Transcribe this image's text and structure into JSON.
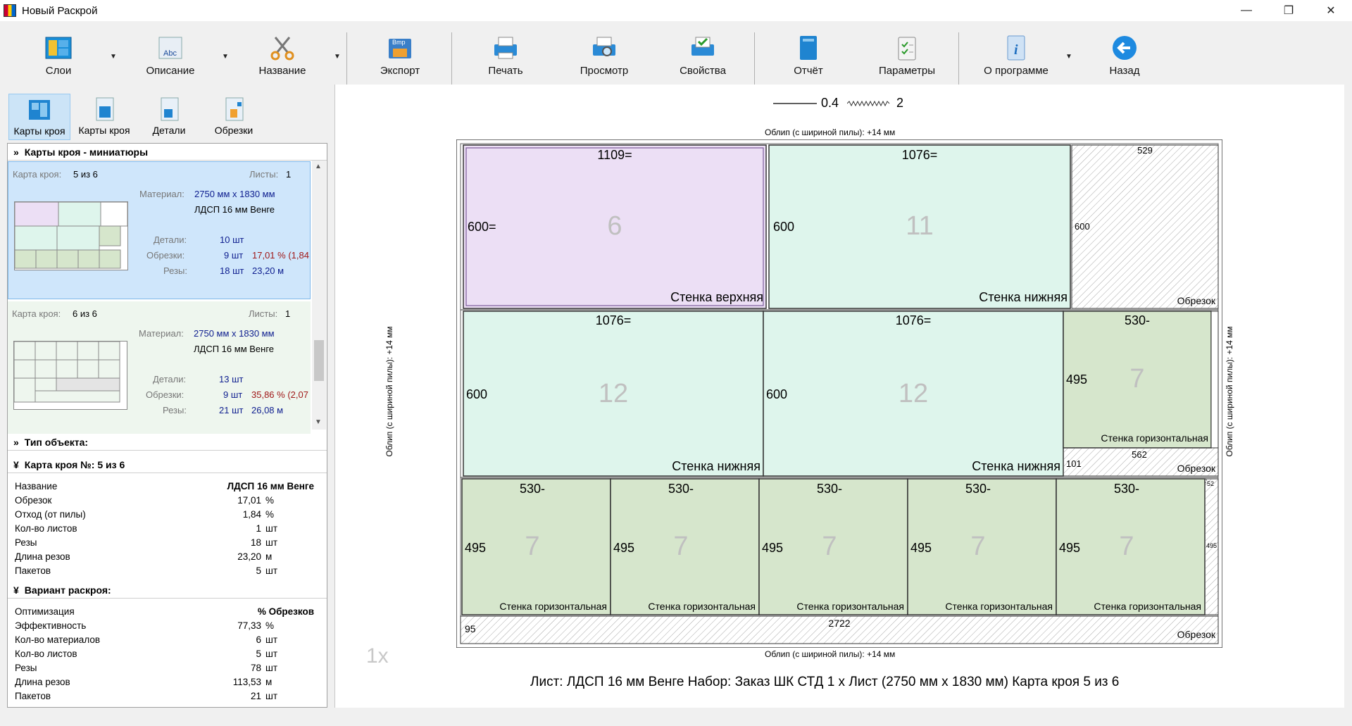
{
  "window": {
    "title": "Новый Раскрой",
    "minimize": "—",
    "maximize": "❐",
    "close": "✕"
  },
  "toolbar": {
    "layers": "Слои",
    "description": "Описание",
    "name": "Название",
    "export": "Экспорт",
    "print": "Печать",
    "preview": "Просмотр",
    "properties": "Свойства",
    "report": "Отчёт",
    "params": "Параметры",
    "about": "О программе",
    "back": "Назад",
    "bmp_badge": "Bmp",
    "abc_badge": "Abc"
  },
  "left_tabs": {
    "cut_maps_1": "Карты кроя",
    "cut_maps_2": "Карты кроя",
    "parts": "Детали",
    "offcuts": "Обрезки"
  },
  "thumbnails": {
    "header": "Карты кроя - миниатюры",
    "cards": [
      {
        "label": "Карта кроя:",
        "num": "5 из 6",
        "sheets_label": "Листы:",
        "sheets": "1",
        "material_label": "Материал:",
        "material": "2750 мм x 1830 мм",
        "material_name": "ЛДСП 16 мм Венге",
        "parts_label": "Детали:",
        "parts": "10 шт",
        "offcuts_label": "Обрезки:",
        "offcuts": "9 шт",
        "offcuts_pct": "17,01 % (1,84",
        "cuts_label": "Резы:",
        "cuts": "18 шт",
        "cuts_len": "23,20 м"
      },
      {
        "label": "Карта кроя:",
        "num": "6 из 6",
        "sheets_label": "Листы:",
        "sheets": "1",
        "material_label": "Материал:",
        "material": "2750 мм x 1830 мм",
        "material_name": "ЛДСП 16 мм Венге",
        "parts_label": "Детали:",
        "parts": "13 шт",
        "offcuts_label": "Обрезки:",
        "offcuts": "9 шт",
        "offcuts_pct": "35,86 % (2,07",
        "cuts_label": "Резы:",
        "cuts": "21 шт",
        "cuts_len": "26,08 м"
      }
    ]
  },
  "object_type": {
    "header": "Тип объекта:"
  },
  "cut_map": {
    "header": "Карта кроя №: 5 из 6",
    "rows": [
      {
        "name": "Название",
        "value": "ЛДСП 16 мм Венге",
        "unit": ""
      },
      {
        "name": "Обрезок",
        "value": "17,01",
        "unit": "%"
      },
      {
        "name": "Отход (от пилы)",
        "value": "1,84",
        "unit": "%"
      },
      {
        "name": "Кол-во листов",
        "value": "1",
        "unit": "шт"
      },
      {
        "name": "Резы",
        "value": "18",
        "unit": "шт"
      },
      {
        "name": "Длина резов",
        "value": "23,20",
        "unit": "м"
      },
      {
        "name": "Пакетов",
        "value": "5",
        "unit": "шт"
      }
    ]
  },
  "variant": {
    "header": "Вариант раскроя:",
    "rows": [
      {
        "name": "Оптимизация",
        "value": "% Обрезков",
        "unit": ""
      },
      {
        "name": "Эффективность",
        "value": "77,33",
        "unit": "%"
      },
      {
        "name": "Кол-во материалов",
        "value": "6",
        "unit": "шт"
      },
      {
        "name": "Кол-во листов",
        "value": "5",
        "unit": "шт"
      },
      {
        "name": "Резы",
        "value": "78",
        "unit": "шт"
      },
      {
        "name": "Длина резов",
        "value": "113,53",
        "unit": "м"
      },
      {
        "name": "Пакетов",
        "value": "21",
        "unit": "шт"
      }
    ]
  },
  "legend": {
    "line_value": "0.4",
    "wave_value": "2"
  },
  "edge_labels": {
    "top": "Облип (с шириной пилы): +14 мм",
    "bottom": "Облип (с шириной пилы): +14 мм",
    "left": "Облип (с шириной пилы): +14 мм",
    "right": "Облип (с шириной пилы): +14 мм"
  },
  "zoom": "1x",
  "footer": "Лист: ЛДСП 16 мм Венге  Набор: Заказ ШК СТД  1 х Лист (2750 мм х 1830 мм)  Карта кроя 5 из 6",
  "pieces": [
    {
      "w": "1109=",
      "h": "600=",
      "num": "6",
      "name": "Стенка верхняя",
      "color": "#ecdff5"
    },
    {
      "w": "1076=",
      "h": "600",
      "num": "11",
      "name": "Стенка нижняя",
      "color": "#def5ec"
    },
    {
      "w": "1076=",
      "h": "600",
      "num": "12",
      "name": "Стенка нижняя",
      "color": "#def5ec"
    },
    {
      "w": "1076=",
      "h": "600",
      "num": "12",
      "name": "Стенка нижняя",
      "color": "#def5ec"
    },
    {
      "w": "530-",
      "h": "495",
      "num": "7",
      "name": "Стенка горизонтальная",
      "color": "#d6e6cc"
    },
    {
      "w": "530-",
      "h": "495",
      "num": "7",
      "name": "Стенка горизонтальная",
      "color": "#d6e6cc"
    },
    {
      "w": "530-",
      "h": "495",
      "num": "7",
      "name": "Стенка горизонтальная",
      "color": "#d6e6cc"
    },
    {
      "w": "530-",
      "h": "495",
      "num": "7",
      "name": "Стенка горизонтальная",
      "color": "#d6e6cc"
    },
    {
      "w": "530-",
      "h": "495",
      "num": "7",
      "name": "Стенка горизонтальная",
      "color": "#d6e6cc"
    },
    {
      "w": "530-",
      "h": "495",
      "num": "7",
      "name": "Стенка горизонтальная",
      "color": "#d6e6cc"
    }
  ],
  "offcuts": [
    {
      "w": "529",
      "h": "600",
      "name": "Обрезок"
    },
    {
      "w": "562",
      "h": "101",
      "name": "Обрезок"
    },
    {
      "w": "52",
      "h": "495",
      "name": ""
    },
    {
      "w": "2722",
      "h": "95",
      "name": "Обрезок"
    }
  ]
}
